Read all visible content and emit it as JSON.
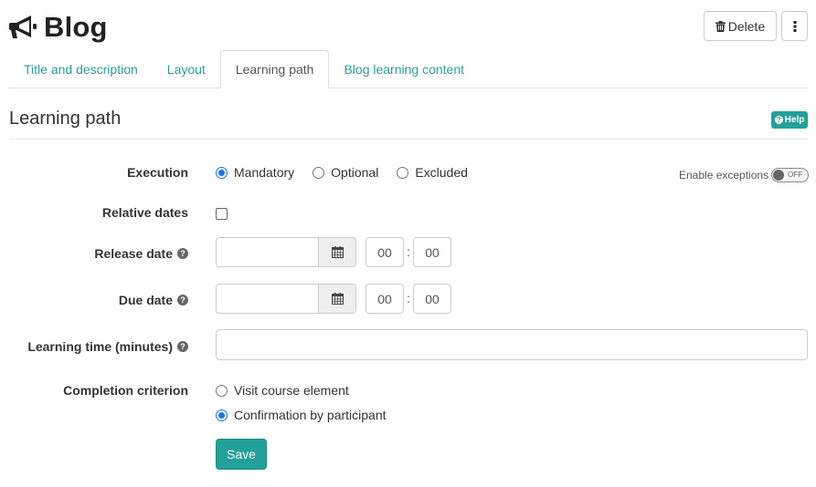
{
  "header": {
    "title": "Blog",
    "title_icon": "megaphone-icon",
    "delete_label": "Delete",
    "delete_icon": "trash-icon",
    "more_icon": "vertical-dots-icon"
  },
  "tabs": [
    {
      "label": "Title and description",
      "active": false
    },
    {
      "label": "Layout",
      "active": false
    },
    {
      "label": "Learning path",
      "active": true
    },
    {
      "label": "Blog learning content",
      "active": false
    }
  ],
  "section": {
    "title": "Learning path",
    "help_label": "Help"
  },
  "form": {
    "execution": {
      "label": "Execution",
      "options": [
        "Mandatory",
        "Optional",
        "Excluded"
      ],
      "selected": "Mandatory"
    },
    "enable_exceptions": {
      "label": "Enable exceptions",
      "state": "OFF"
    },
    "relative_dates": {
      "label": "Relative dates",
      "checked": false
    },
    "release_date": {
      "label": "Release date",
      "value": "",
      "hour": "00",
      "minute": "00"
    },
    "due_date": {
      "label": "Due date",
      "value": "",
      "hour": "00",
      "minute": "00"
    },
    "time_separator": ":",
    "learning_time": {
      "label": "Learning time (minutes)",
      "value": ""
    },
    "completion_criterion": {
      "label": "Completion criterion",
      "options": [
        "Visit course element",
        "Confirmation by participant"
      ],
      "selected": "Confirmation by participant"
    },
    "save_label": "Save"
  },
  "colors": {
    "accent": "#23a09a",
    "link": "#2a9d9a",
    "radio_checked": "#1a73e8"
  }
}
